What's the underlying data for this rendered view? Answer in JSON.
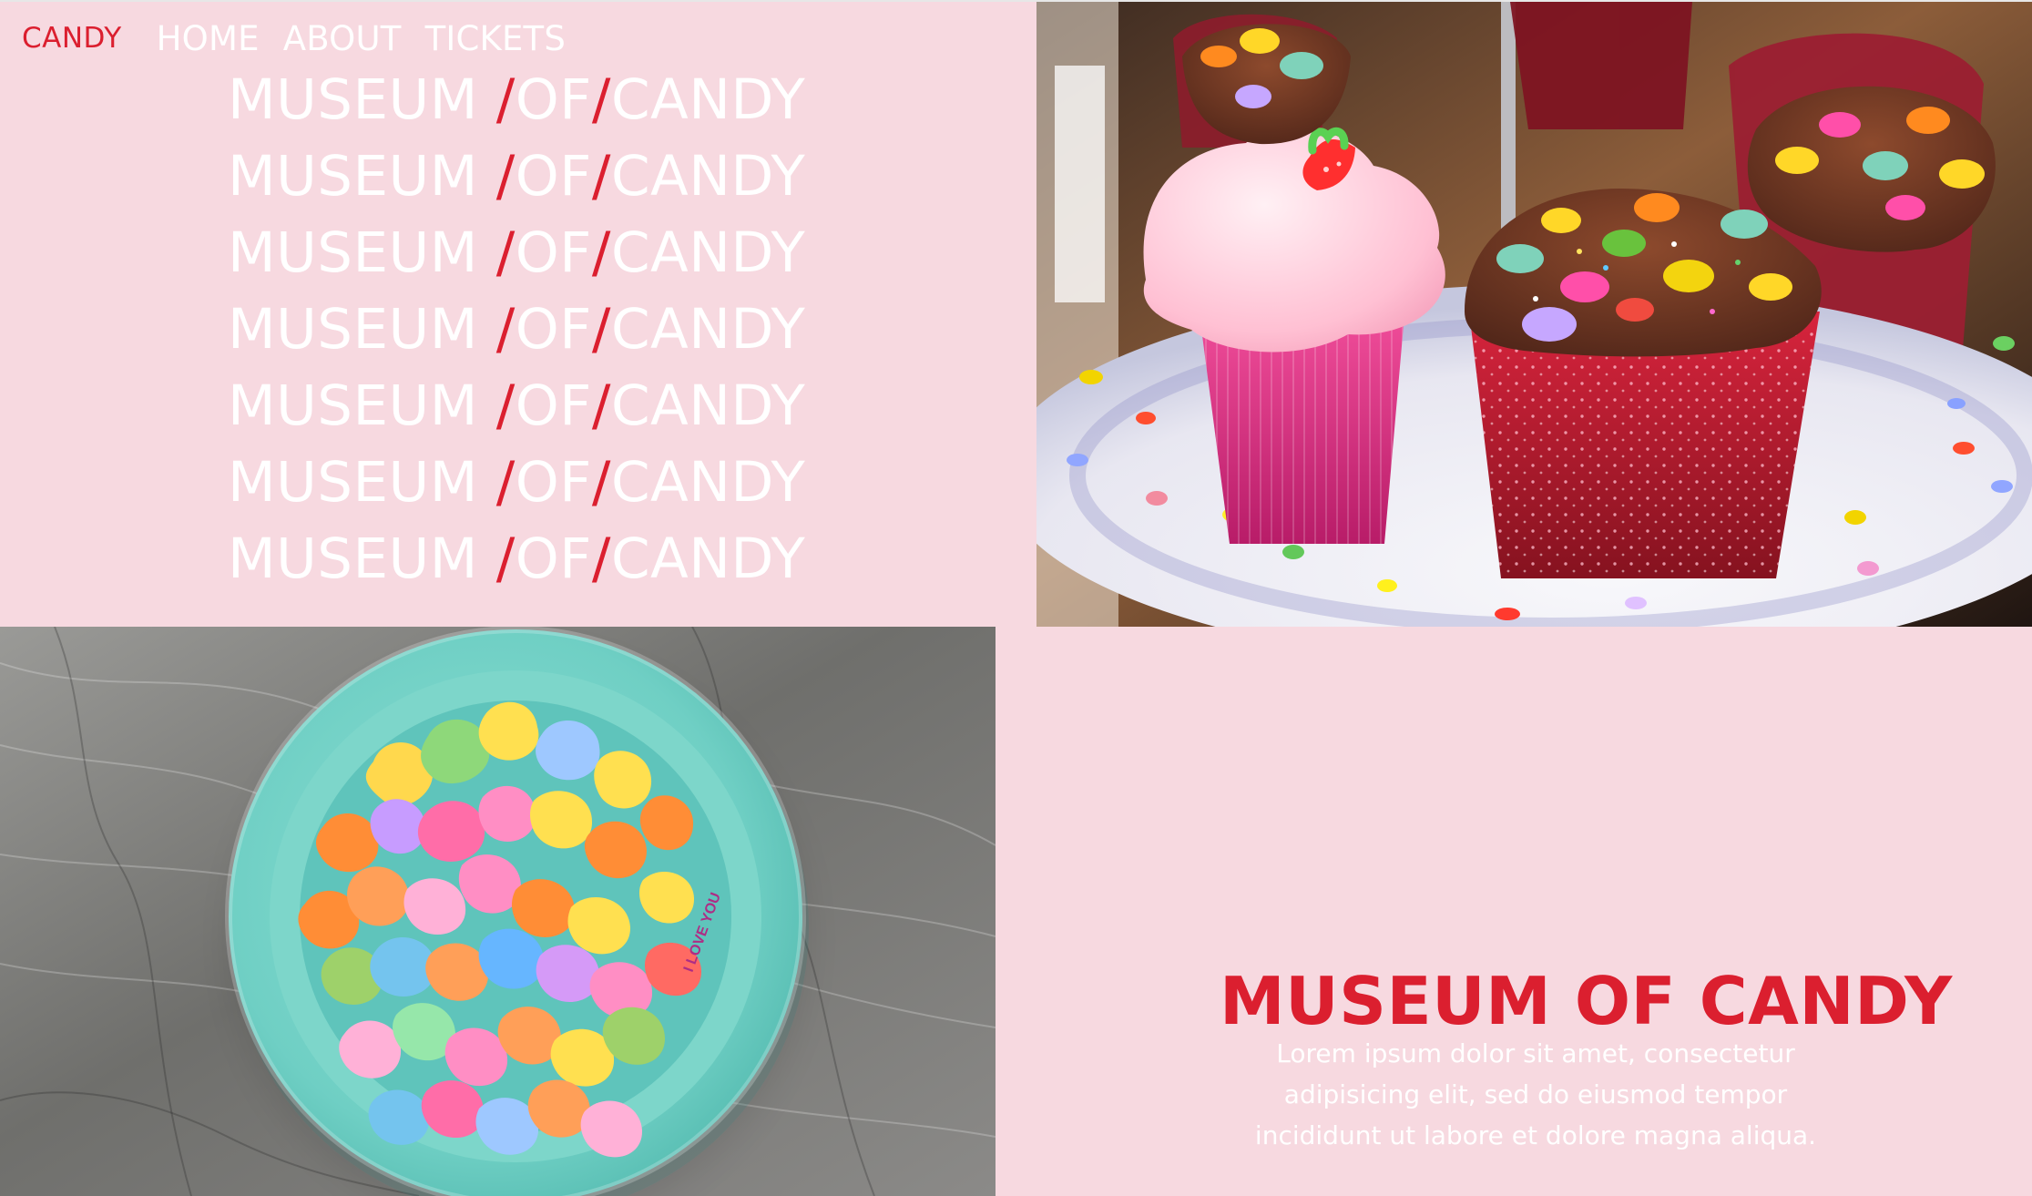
{
  "nav": {
    "brand": "CANDY",
    "links": [
      "HOME",
      "ABOUT",
      "TICKETS"
    ]
  },
  "hero": {
    "line_parts": {
      "museum": "MUSEUM ",
      "slash1": "/",
      "of": "OF",
      "slash2": "/",
      "candy": "CANDY"
    }
  },
  "info": {
    "title": "MUSEUM OF CANDY",
    "description": "Lorem ipsum dolor sit amet, consectetur adipisicing elit, sed do eiusmod tempor incididunt ut labore et dolore magna aliqua."
  },
  "images": {
    "cupcakes": "cupcakes-image",
    "candy_bowl": "candy-bowl-image",
    "bowl_text": "I LOVE YOU"
  },
  "colors": {
    "background": "#f7d9e0",
    "accent": "#db1f2f",
    "text_light": "#ffffff",
    "bowl": "#7fd4c7",
    "wood": "#7c7c78"
  }
}
